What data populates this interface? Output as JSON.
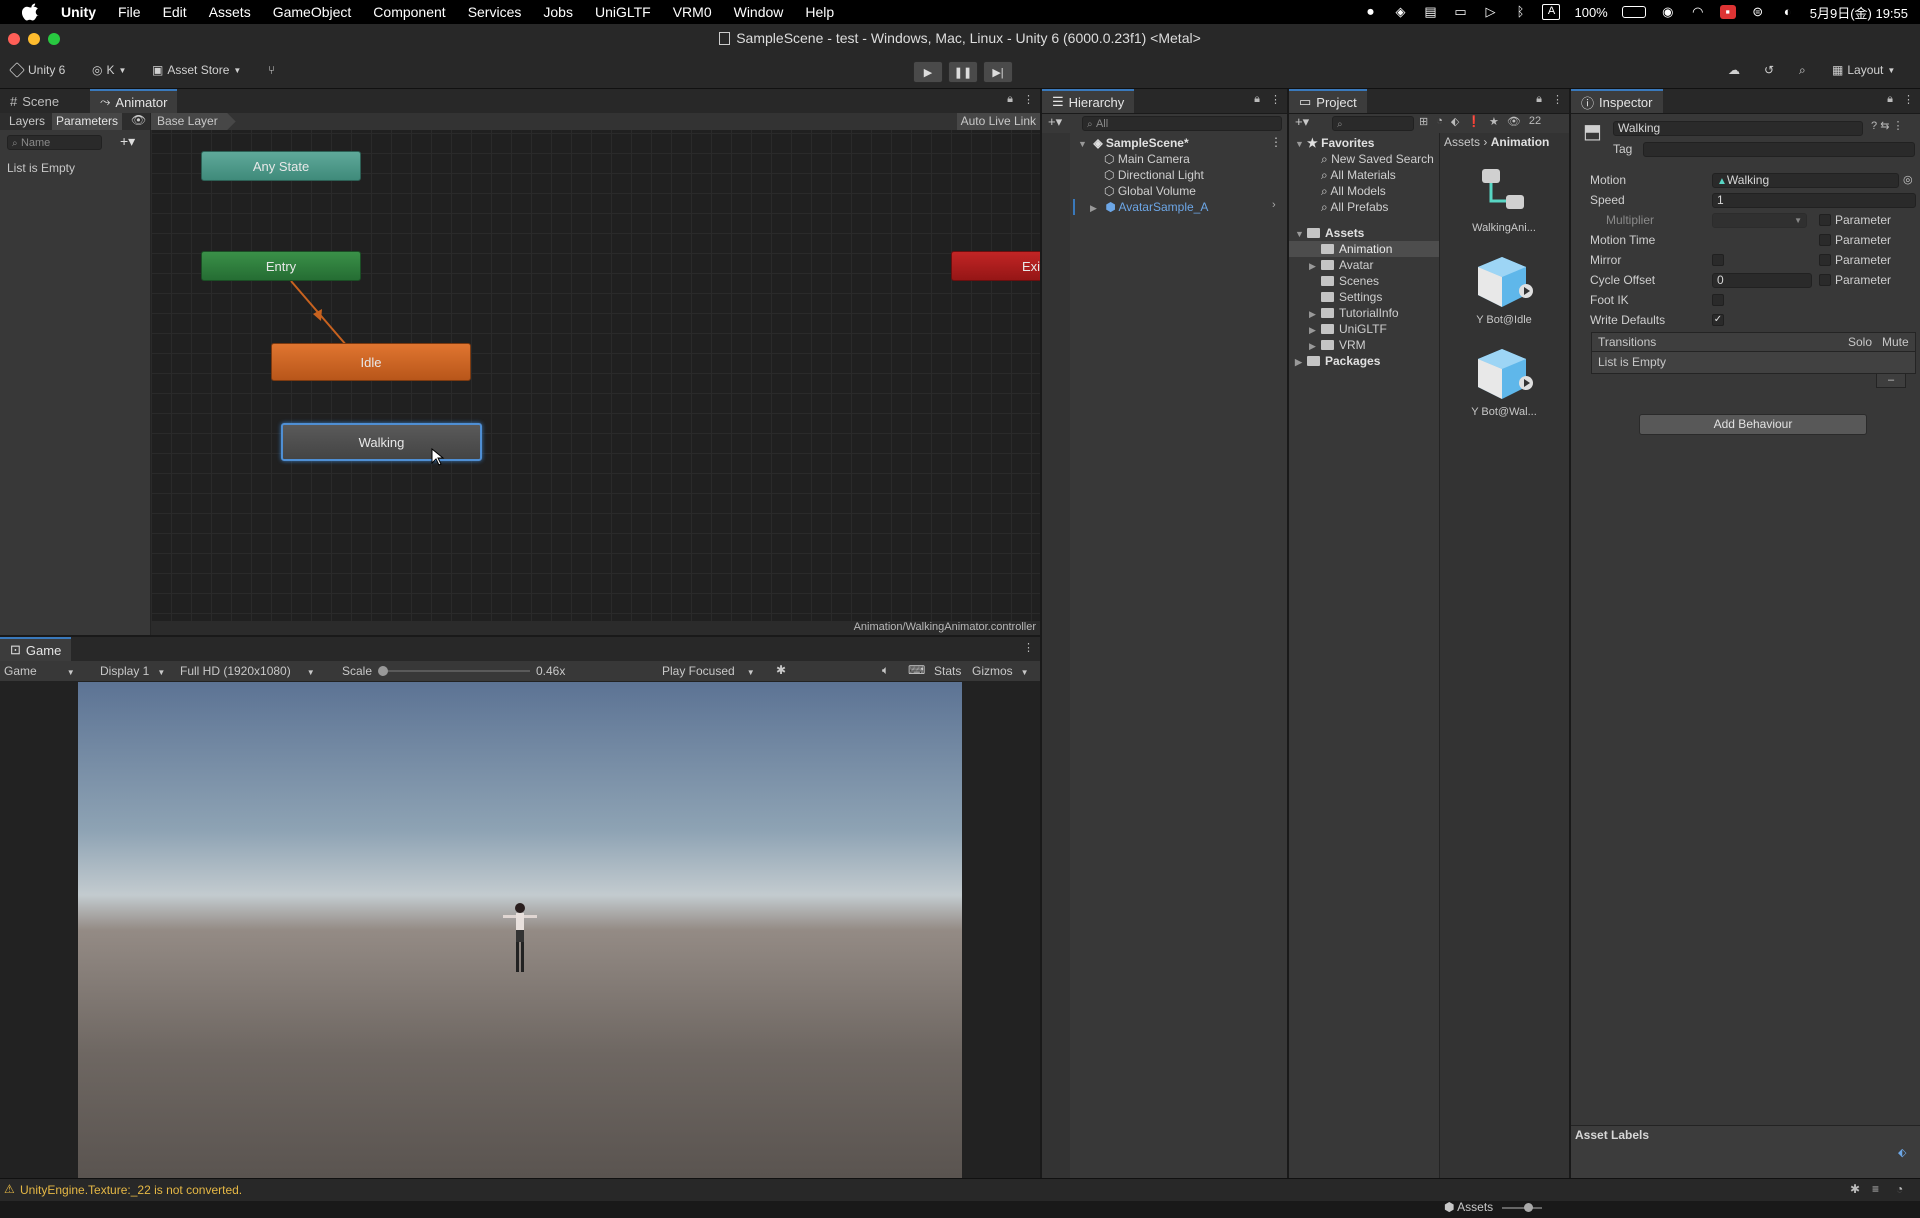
{
  "menubar": {
    "items": [
      "Unity",
      "File",
      "Edit",
      "Assets",
      "GameObject",
      "Component",
      "Services",
      "Jobs",
      "UniGLTF",
      "VRM0",
      "Window",
      "Help"
    ],
    "battery": "100%",
    "datetime": "5月9日(金)  19:55",
    "input_mode": "A"
  },
  "window": {
    "title": "SampleScene - test - Windows, Mac, Linux - Unity 6 (6000.0.23f1) <Metal>"
  },
  "toolbar": {
    "unity_label": "Unity 6",
    "account": "K",
    "asset_store": "Asset Store",
    "layout": "Layout"
  },
  "scene_tabs": {
    "scene": "Scene",
    "animator": "Animator"
  },
  "animator": {
    "layers_tab": "Layers",
    "parameters_tab": "Parameters",
    "search_placeholder": "Name",
    "list_empty": "List is Empty",
    "breadcrumb": "Base Layer",
    "auto_live_link": "Auto Live Link",
    "footer_path": "Animation/WalkingAnimator.controller",
    "nodes": {
      "any_state": "Any State",
      "entry": "Entry",
      "exit": "Exit",
      "idle": "Idle",
      "walking": "Walking"
    }
  },
  "game": {
    "tab": "Game",
    "mode": "Game",
    "display": "Display 1",
    "resolution": "Full HD (1920x1080)",
    "scale_label": "Scale",
    "scale_value": "0.46x",
    "play_focused": "Play Focused",
    "stats": "Stats",
    "gizmos": "Gizmos"
  },
  "hierarchy": {
    "tab": "Hierarchy",
    "search_placeholder": "All",
    "scene": "SampleScene*",
    "items": [
      "Main Camera",
      "Directional Light",
      "Global Volume",
      "AvatarSample_A"
    ]
  },
  "project": {
    "tab": "Project",
    "badge": "22",
    "favorites_title": "Favorites",
    "favorites": [
      "New Saved Search",
      "All Materials",
      "All Models",
      "All Prefabs"
    ],
    "assets_title": "Assets",
    "asset_folders": [
      "Animation",
      "Avatar",
      "Scenes",
      "Settings",
      "TutorialInfo",
      "UniGLTF",
      "VRM"
    ],
    "packages": "Packages",
    "breadcrumb_root": "Assets",
    "breadcrumb_leaf": "Animation",
    "files": [
      "WalkingAni...",
      "Y Bot@Idle",
      "Y Bot@Wal..."
    ],
    "footer": "Assets"
  },
  "inspector": {
    "tab": "Inspector",
    "name": "Walking",
    "tag_label": "Tag",
    "motion_label": "Motion",
    "motion_value": "Walking",
    "speed_label": "Speed",
    "speed_value": "1",
    "multiplier_label": "Multiplier",
    "motion_time_label": "Motion Time",
    "mirror_label": "Mirror",
    "cycle_offset_label": "Cycle Offset",
    "cycle_offset_value": "0",
    "foot_ik_label": "Foot IK",
    "write_defaults_label": "Write Defaults",
    "parameter_label": "Parameter",
    "transitions_label": "Transitions",
    "solo_label": "Solo",
    "mute_label": "Mute",
    "list_empty": "List is Empty",
    "add_behaviour": "Add Behaviour",
    "asset_labels": "Asset Labels"
  },
  "status": {
    "warning": "UnityEngine.Texture:_22 is not converted."
  },
  "colors": {
    "accent": "#3a79bb",
    "any_state": "#4f9788",
    "entry": "#2e7a3d",
    "exit": "#a51b1b",
    "idle": "#c8621f",
    "warning": "#e6b845"
  }
}
